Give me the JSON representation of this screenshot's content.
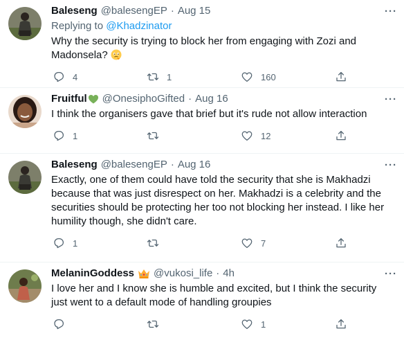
{
  "tweets": [
    {
      "display_name": "Baleseng",
      "handle": "@balesengEP",
      "dot": "·",
      "time": "Aug 15",
      "more": "···",
      "reply_prefix": "Replying to",
      "reply_mention": "@Khadzinator",
      "text": "Why the security is trying to block her from engaging with Zozi and Madonsela?",
      "emoji": "thinking-face-emoji",
      "stats": {
        "replies": "4",
        "retweets": "1",
        "likes": "160"
      }
    },
    {
      "display_name": "Fruitful",
      "name_emoji": "green-heart-emoji",
      "handle": "@OnesiphoGifted",
      "dot": "·",
      "time": "Aug 16",
      "more": "···",
      "text": "I think the organisers gave that brief but it's rude not allow interaction",
      "stats": {
        "replies": "1",
        "retweets": "",
        "likes": "12"
      }
    },
    {
      "display_name": "Baleseng",
      "handle": "@balesengEP",
      "dot": "·",
      "time": "Aug 16",
      "more": "···",
      "text": "Exactly, one of them could have told the security that she is Makhadzi because that was just disrespect on her. Makhadzi is a celebrity and the securities should be protecting her too not blocking her instead. I like her humility though, she didn't care.",
      "stats": {
        "replies": "1",
        "retweets": "",
        "likes": "7"
      }
    },
    {
      "display_name": "MelaninGoddess",
      "name_emoji": "crown-emoji",
      "handle": "@vukosi_life",
      "dot": "·",
      "time": "4h",
      "more": "···",
      "text": "I love her and I know she is humble and excited, but I think the security just went to a default mode of handling groupies",
      "stats": {
        "replies": "",
        "retweets": "",
        "likes": "1"
      }
    }
  ],
  "colors": {
    "text": "#0f1419",
    "secondary": "#536471",
    "link": "#1d9bf0",
    "divider": "#eff3f4"
  }
}
